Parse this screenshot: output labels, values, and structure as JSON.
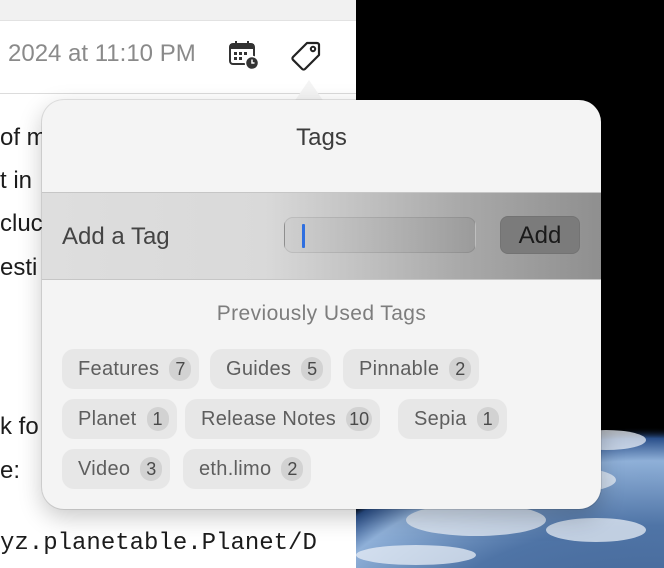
{
  "editor": {
    "date_text": "2024 at 11:10 PM",
    "body_lines": [
      "of m",
      "t in",
      "cluc",
      "esti",
      "k fo",
      "e:"
    ],
    "code_line": "yz.planetable.Planet/D"
  },
  "popover": {
    "title": "Tags",
    "add_label": "Add a Tag",
    "input_value": "",
    "add_button": "Add",
    "previous_title": "Previously Used Tags",
    "tags": [
      {
        "label": "Features",
        "count": "7"
      },
      {
        "label": "Guides",
        "count": "5"
      },
      {
        "label": "Pinnable",
        "count": "2"
      },
      {
        "label": "Planet",
        "count": "1"
      },
      {
        "label": "Release Notes",
        "count": "10"
      },
      {
        "label": "Sepia",
        "count": "1"
      },
      {
        "label": "Video",
        "count": "3"
      },
      {
        "label": "eth.limo",
        "count": "2"
      }
    ]
  }
}
